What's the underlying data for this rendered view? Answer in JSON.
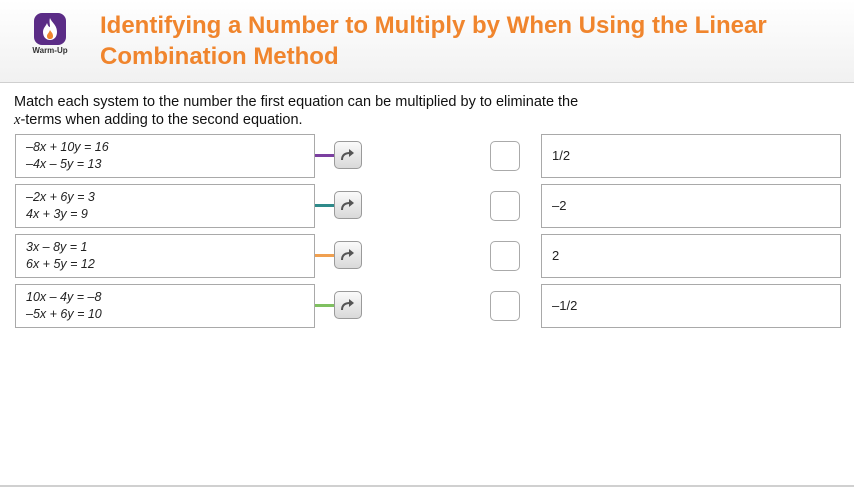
{
  "header": {
    "logo_label": "Warm-Up",
    "title": "Identifying a Number to Multiply by When Using the Linear Combination Method"
  },
  "instructions": {
    "part1": "Match each system to the number the first equation can be multiplied by to eliminate the",
    "var": "x",
    "part2": "-terms when adding to the second equation."
  },
  "prompts": [
    {
      "line1": "–8x + 10y = 16",
      "line2": "–4x – 5y = 13",
      "connector_color": "#7b3fa0"
    },
    {
      "line1": "–2x + 6y = 3",
      "line2": "4x + 3y = 9",
      "connector_color": "#2e8a8a"
    },
    {
      "line1": "3x – 8y = 1",
      "line2": "6x + 5y = 12",
      "connector_color": "#f0a050"
    },
    {
      "line1": "10x – 4y = –8",
      "line2": "–5x + 6y = 10",
      "connector_color": "#7fc060"
    }
  ],
  "answers": [
    {
      "label": "1/2"
    },
    {
      "label": "–2"
    },
    {
      "label": "2"
    },
    {
      "label": "–1/2"
    }
  ],
  "icons": {
    "logo": "flame-icon",
    "arrow": "curved-arrow-right-icon"
  },
  "colors": {
    "title": "#f0852d",
    "logo_bg": "#5b2c86"
  }
}
